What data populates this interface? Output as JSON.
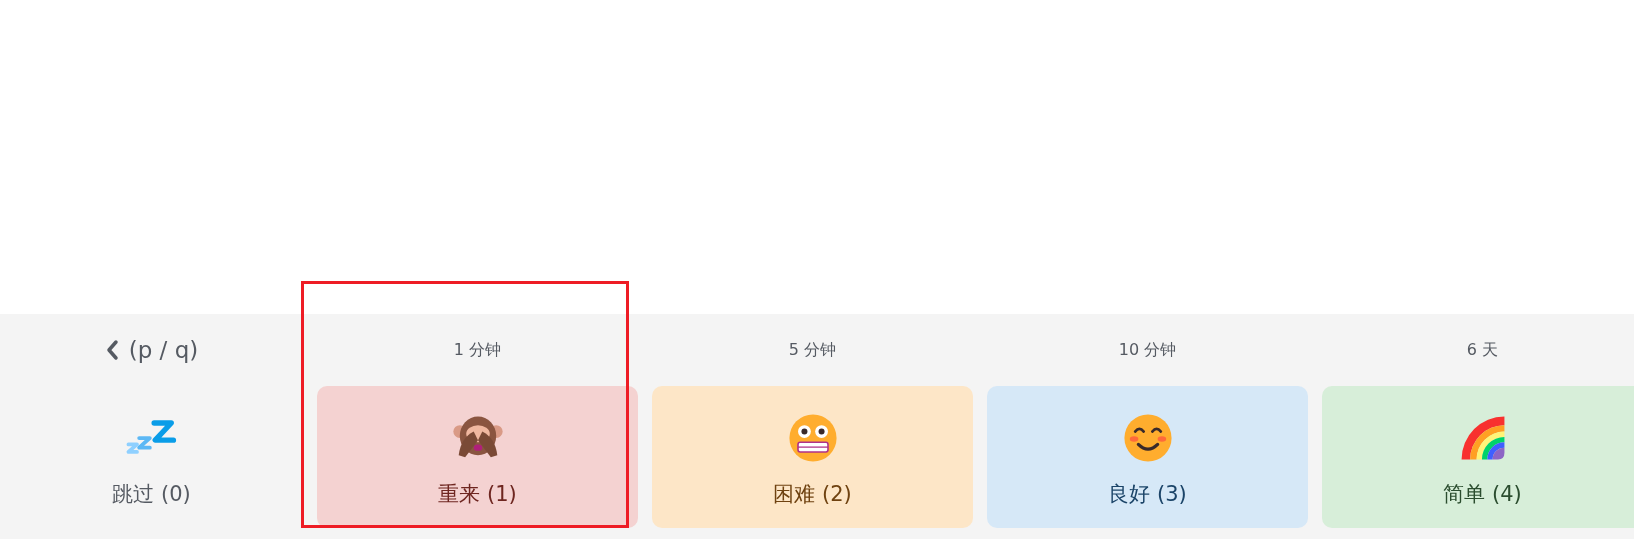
{
  "back": {
    "label": "(p / q)"
  },
  "buttons": [
    {
      "kind": "skip",
      "label": "跳过 (0)"
    },
    {
      "kind": "answer",
      "interval": "1 分钟",
      "label": "重来 (1)",
      "color": "#f4d2d1",
      "highlighted": true
    },
    {
      "kind": "answer",
      "interval": "5 分钟",
      "label": "困难 (2)",
      "color": "#fde6c7",
      "highlighted": false
    },
    {
      "kind": "answer",
      "interval": "10 分钟",
      "label": "良好 (3)",
      "color": "#d6e8f7",
      "highlighted": false
    },
    {
      "kind": "answer",
      "interval": "6 天",
      "label": "简单 (4)",
      "color": "#d7eed9",
      "highlighted": false
    }
  ]
}
